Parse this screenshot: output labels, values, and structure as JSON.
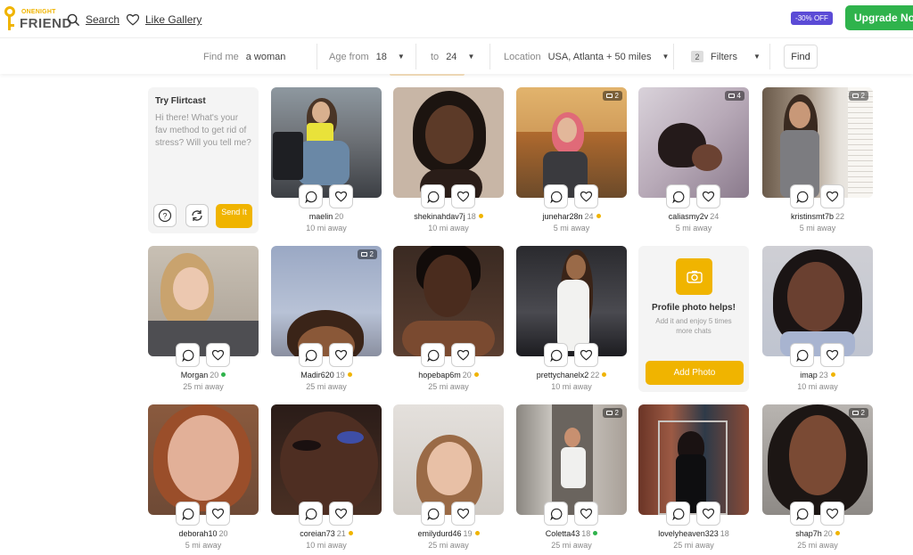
{
  "header": {
    "logo_line1": "ONENIGHT",
    "logo_line2": "FRIEND",
    "search_label": "Search",
    "gallery_label": "Like Gallery",
    "promo_badge": "-30% OFF",
    "upgrade_label": "Upgrade Now"
  },
  "filters": {
    "find_me_label": "Find me",
    "find_me_value": "a woman",
    "age_from_label": "Age from",
    "age_from_value": "18",
    "age_to_label": "to",
    "age_to_value": "24",
    "location_label": "Location",
    "location_value": "USA, Atlanta + 50 miles",
    "filters_count": "2",
    "filters_label": "Filters",
    "find_button": "Find"
  },
  "flirtcast": {
    "title": "Try Flirtcast",
    "message": "Hi there! What's your fav method to get rid of stress? Will you tell me?",
    "send_label": "Send It"
  },
  "add_photo": {
    "title": "Profile photo helps!",
    "text": "Add it and enjoy 5 times more chats",
    "button": "Add Photo"
  },
  "colors": {
    "accent": "#f0b400",
    "upgrade": "#2fb34c",
    "promo": "#5b4bd6",
    "online": "#2fb34c",
    "recent": "#f0b400"
  },
  "profiles": [
    {
      "name": "maelin",
      "age": "20",
      "distance": "10 mi away",
      "status": "none",
      "photos": ""
    },
    {
      "name": "shekinahdav7j",
      "age": "18",
      "distance": "10 mi away",
      "status": "recent",
      "photos": ""
    },
    {
      "name": "junehar28n",
      "age": "24",
      "distance": "5 mi away",
      "status": "recent",
      "photos": "2"
    },
    {
      "name": "caliasmy2v",
      "age": "24",
      "distance": "5 mi away",
      "status": "none",
      "photos": "4"
    },
    {
      "name": "kristinsmt7b",
      "age": "22",
      "distance": "5 mi away",
      "status": "none",
      "photos": "2"
    },
    {
      "name": "Morgan",
      "age": "20",
      "distance": "25 mi away",
      "status": "online",
      "photos": ""
    },
    {
      "name": "Madir620",
      "age": "19",
      "distance": "25 mi away",
      "status": "recent",
      "photos": "2"
    },
    {
      "name": "hopebap6m",
      "age": "20",
      "distance": "25 mi away",
      "status": "recent",
      "photos": ""
    },
    {
      "name": "prettychanelx2",
      "age": "22",
      "distance": "10 mi away",
      "status": "recent",
      "photos": ""
    },
    {
      "name": "imap",
      "age": "23",
      "distance": "10 mi away",
      "status": "recent",
      "photos": ""
    },
    {
      "name": "deborah10",
      "age": "20",
      "distance": "5 mi away",
      "status": "none",
      "photos": ""
    },
    {
      "name": "coreian73",
      "age": "21",
      "distance": "10 mi away",
      "status": "recent",
      "photos": ""
    },
    {
      "name": "emilydurd46",
      "age": "19",
      "distance": "25 mi away",
      "status": "recent",
      "photos": ""
    },
    {
      "name": "Coletta43",
      "age": "18",
      "distance": "25 mi away",
      "status": "online",
      "photos": "2"
    },
    {
      "name": "lovelyheaven323",
      "age": "18",
      "distance": "25 mi away",
      "status": "none",
      "photos": ""
    },
    {
      "name": "shap7h",
      "age": "20",
      "distance": "25 mi away",
      "status": "recent",
      "photos": "2"
    }
  ]
}
